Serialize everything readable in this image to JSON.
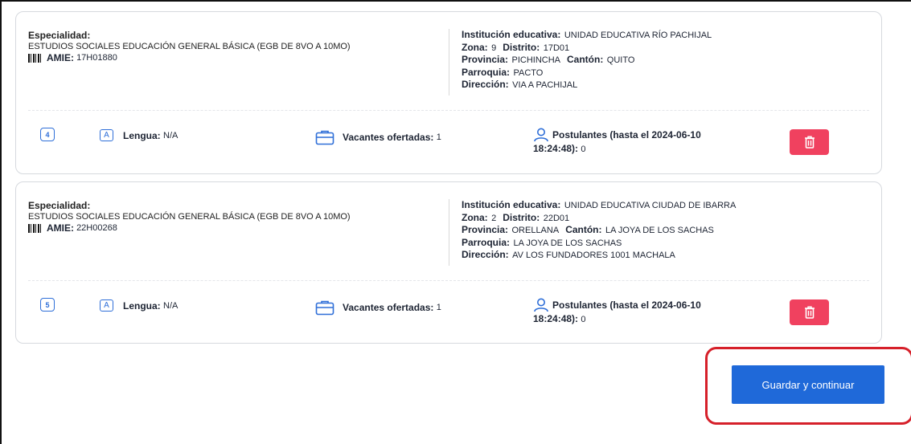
{
  "labels": {
    "especialidad": "Especialidad:",
    "amie": "AMIE:",
    "institucion": "Institución educativa:",
    "zona": "Zona:",
    "distrito": "Distrito:",
    "provincia": "Provincia:",
    "canton": "Cantón:",
    "parroquia": "Parroquia:",
    "direccion": "Dirección:",
    "lengua": "Lengua:",
    "vacantes": "Vacantes ofertadas:",
    "postulantes_line1": "Postulantes (hasta el 2024-06-10",
    "postulantes_line2": "18:24:48):",
    "lengua_icon_letter": "A"
  },
  "cards": [
    {
      "especialidad": "ESTUDIOS SOCIALES EDUCACIÓN GENERAL BÁSICA (EGB DE 8VO A 10MO)",
      "amie": "17H01880",
      "institucion": "UNIDAD EDUCATIVA RÍO PACHIJAL",
      "zona": "9",
      "distrito": "17D01",
      "provincia": "PICHINCHA",
      "canton": "QUITO",
      "parroquia": "PACTO",
      "direccion": "VIA A PACHIJAL",
      "number": "4",
      "lengua": "N/A",
      "vacantes": "1",
      "postulantes": "0"
    },
    {
      "especialidad": "ESTUDIOS SOCIALES EDUCACIÓN GENERAL BÁSICA (EGB DE 8VO A 10MO)",
      "amie": "22H00268",
      "institucion": "UNIDAD EDUCATIVA CIUDAD DE IBARRA",
      "zona": "2",
      "distrito": "22D01",
      "provincia": "ORELLANA",
      "canton": "LA JOYA DE LOS SACHAS",
      "parroquia": "LA JOYA DE LOS SACHAS",
      "direccion": "AV LOS FUNDADORES 1001 MACHALA",
      "number": "5",
      "lengua": "N/A",
      "vacantes": "1",
      "postulantes": "0"
    }
  ],
  "icons": {
    "barcode": "barcode-icon",
    "language": "language-icon",
    "briefcase": "briefcase-icon",
    "user": "user-icon",
    "trash": "trash-icon"
  },
  "colors": {
    "accent": "#1f69d9",
    "delete": "#f0415f",
    "highlight": "#d6202a"
  },
  "actions": {
    "save_label": "Guardar y continuar"
  }
}
